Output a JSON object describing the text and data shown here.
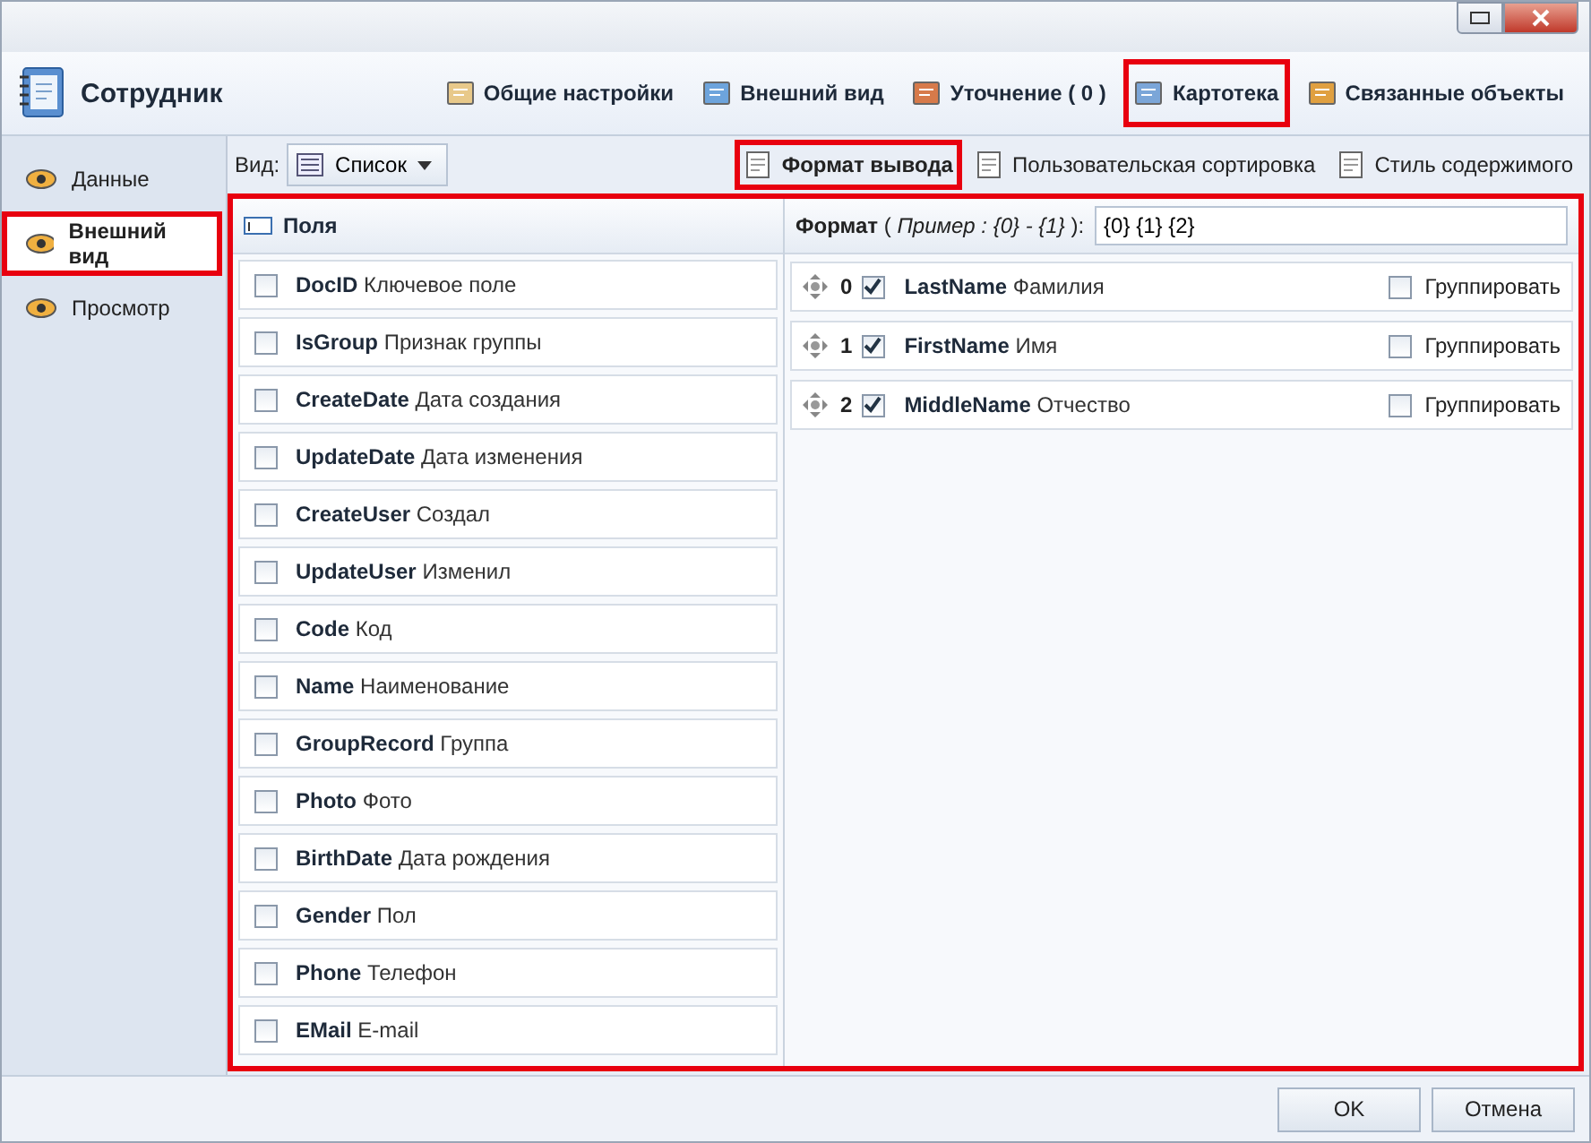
{
  "window": {
    "title": "Сотрудник"
  },
  "toolbar": [
    {
      "label": "Общие настройки",
      "highlighted": false
    },
    {
      "label": "Внешний вид",
      "highlighted": false
    },
    {
      "label": "Уточнение ( 0 )",
      "highlighted": false
    },
    {
      "label": "Картотека",
      "highlighted": true
    },
    {
      "label": "Связанные объекты",
      "highlighted": false
    }
  ],
  "sidebar": {
    "items": [
      {
        "label": "Данные",
        "selected": false,
        "highlighted": false
      },
      {
        "label": "Внешний вид",
        "selected": true,
        "highlighted": true
      },
      {
        "label": "Просмотр",
        "selected": false,
        "highlighted": false
      }
    ]
  },
  "view": {
    "label": "Вид:",
    "value": "Список"
  },
  "subtabs": [
    {
      "label": "Формат вывода",
      "selected": true,
      "highlighted": true
    },
    {
      "label": "Пользовательская сортировка",
      "selected": false,
      "highlighted": false
    },
    {
      "label": "Стиль содержимого",
      "selected": false,
      "highlighted": false
    }
  ],
  "main_highlighted": true,
  "fields": {
    "title": "Поля",
    "rows": [
      {
        "name": "DocID",
        "caption": "Ключевое поле",
        "checked": false
      },
      {
        "name": "IsGroup",
        "caption": "Признак группы",
        "checked": false
      },
      {
        "name": "CreateDate",
        "caption": "Дата создания",
        "checked": false
      },
      {
        "name": "UpdateDate",
        "caption": "Дата изменения",
        "checked": false
      },
      {
        "name": "CreateUser",
        "caption": "Создал",
        "checked": false
      },
      {
        "name": "UpdateUser",
        "caption": "Изменил",
        "checked": false
      },
      {
        "name": "Code",
        "caption": "Код",
        "checked": false
      },
      {
        "name": "Name",
        "caption": "Наименование",
        "checked": false
      },
      {
        "name": "GroupRecord",
        "caption": "Группа",
        "checked": false
      },
      {
        "name": "Photo",
        "caption": "Фото",
        "checked": false
      },
      {
        "name": "BirthDate",
        "caption": "Дата рождения",
        "checked": false
      },
      {
        "name": "Gender",
        "caption": "Пол",
        "checked": false
      },
      {
        "name": "Phone",
        "caption": "Телефон",
        "checked": false
      },
      {
        "name": "EMail",
        "caption": "E-mail",
        "checked": false
      }
    ]
  },
  "format": {
    "label": "Формат",
    "example": "( *Пример : {0} - {1}* ):",
    "value": "{0} {1} {2}",
    "rows": [
      {
        "index": "0",
        "name": "LastName",
        "caption": "Фамилия",
        "checked": true,
        "group_label": "Группировать",
        "grouped": false
      },
      {
        "index": "1",
        "name": "FirstName",
        "caption": "Имя",
        "checked": true,
        "group_label": "Группировать",
        "grouped": false
      },
      {
        "index": "2",
        "name": "MiddleName",
        "caption": "Отчество",
        "checked": true,
        "group_label": "Группировать",
        "grouped": false
      }
    ]
  },
  "buttons": [
    "OK",
    "Отмена"
  ]
}
